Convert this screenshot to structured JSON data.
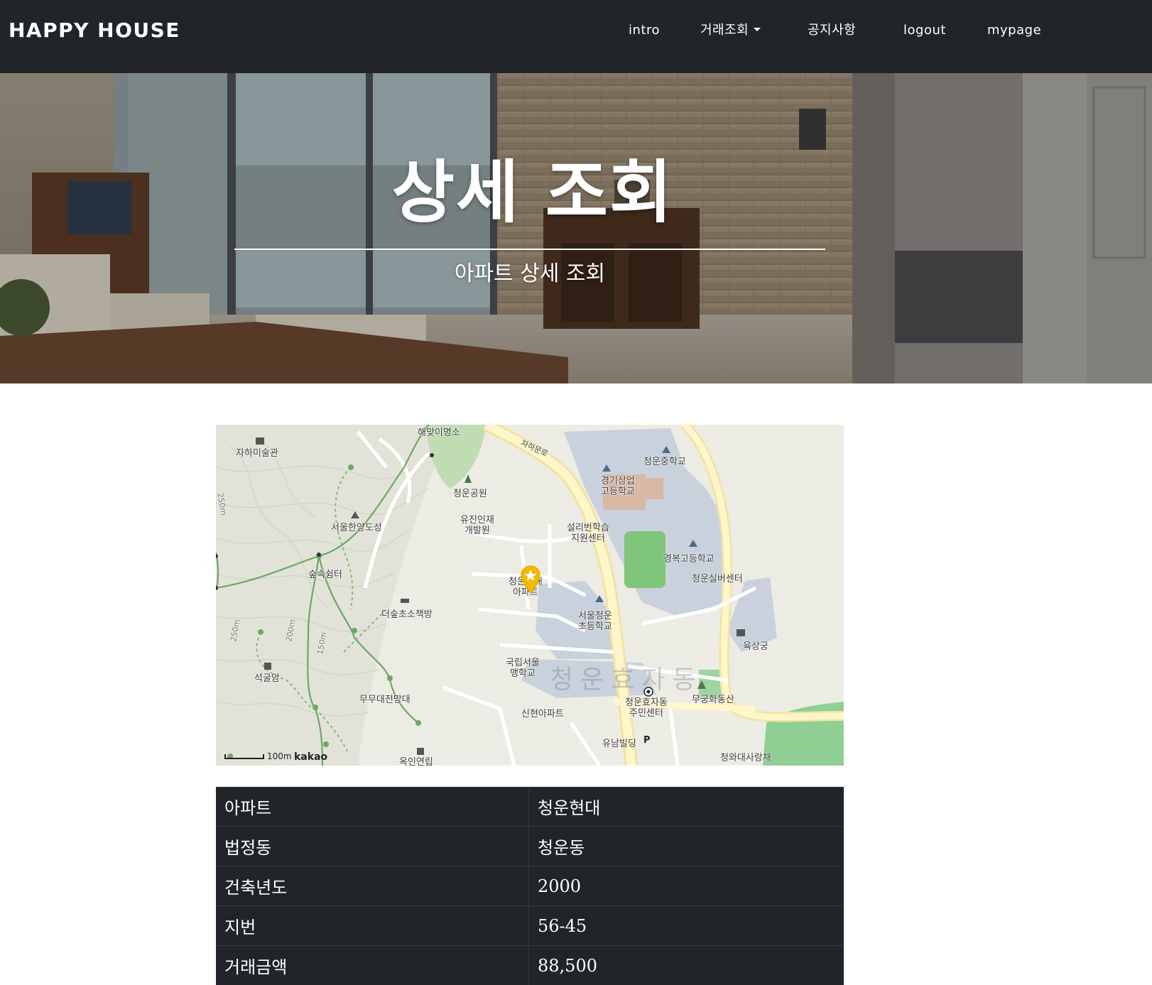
{
  "navbar": {
    "brand": "HAPPY HOUSE",
    "links": {
      "intro": "intro",
      "deals": "거래조회",
      "notice": "공지사항",
      "logout": "logout",
      "mypage": "mypage"
    }
  },
  "hero": {
    "title": "상세 조회",
    "subtitle": "아파트 상세 조회"
  },
  "map": {
    "labels": {
      "haemaji": "해맞이명소",
      "jaha_museum": "자하미술관",
      "jaharo": "자하문로",
      "cheongun_middle": "청운중학교",
      "gyeonggi_commercial": "경기상업\n고등학교",
      "cheongun_park": "청운공원",
      "yujin": "유진인재\n개발원",
      "seoul_hanyang": "서울한양도성",
      "seolri": "설리번학습\n지원센터",
      "gyeongbok_high": "경복고등학교",
      "sup_shelter": "숲속쉼터",
      "cheongun_apt": "청운현대\n아파트",
      "cheongun_silver": "청운실버센터",
      "deosup": "더숲초소책방",
      "seoul_cheongun_elem": "서울청운\n초등학교",
      "yuksanggung": "육상궁",
      "seokgulam": "석굴암",
      "gukrip_maeng": "국립서울\n맹학교",
      "district": "청운효자동",
      "mumudae": "무무대전망대",
      "sinhyeon_apt": "신현아파트",
      "community_center": "청운효자동\n주민센터",
      "mugunghwa": "무궁화동산",
      "yunam": "유남빌딩",
      "ogin": "옥인연립",
      "cheongwadae": "청와대사랑채",
      "c250a": "250m",
      "c250b": "250m",
      "c200": "200m",
      "c150": "150m"
    },
    "scale": "100m",
    "logo": "kakao"
  },
  "details": [
    {
      "key": "아파트",
      "value": "청운현대"
    },
    {
      "key": "법정동",
      "value": "청운동"
    },
    {
      "key": "건축년도",
      "value": "2000"
    },
    {
      "key": "지번",
      "value": "56-45"
    },
    {
      "key": "거래금액",
      "value": "88,500"
    }
  ]
}
